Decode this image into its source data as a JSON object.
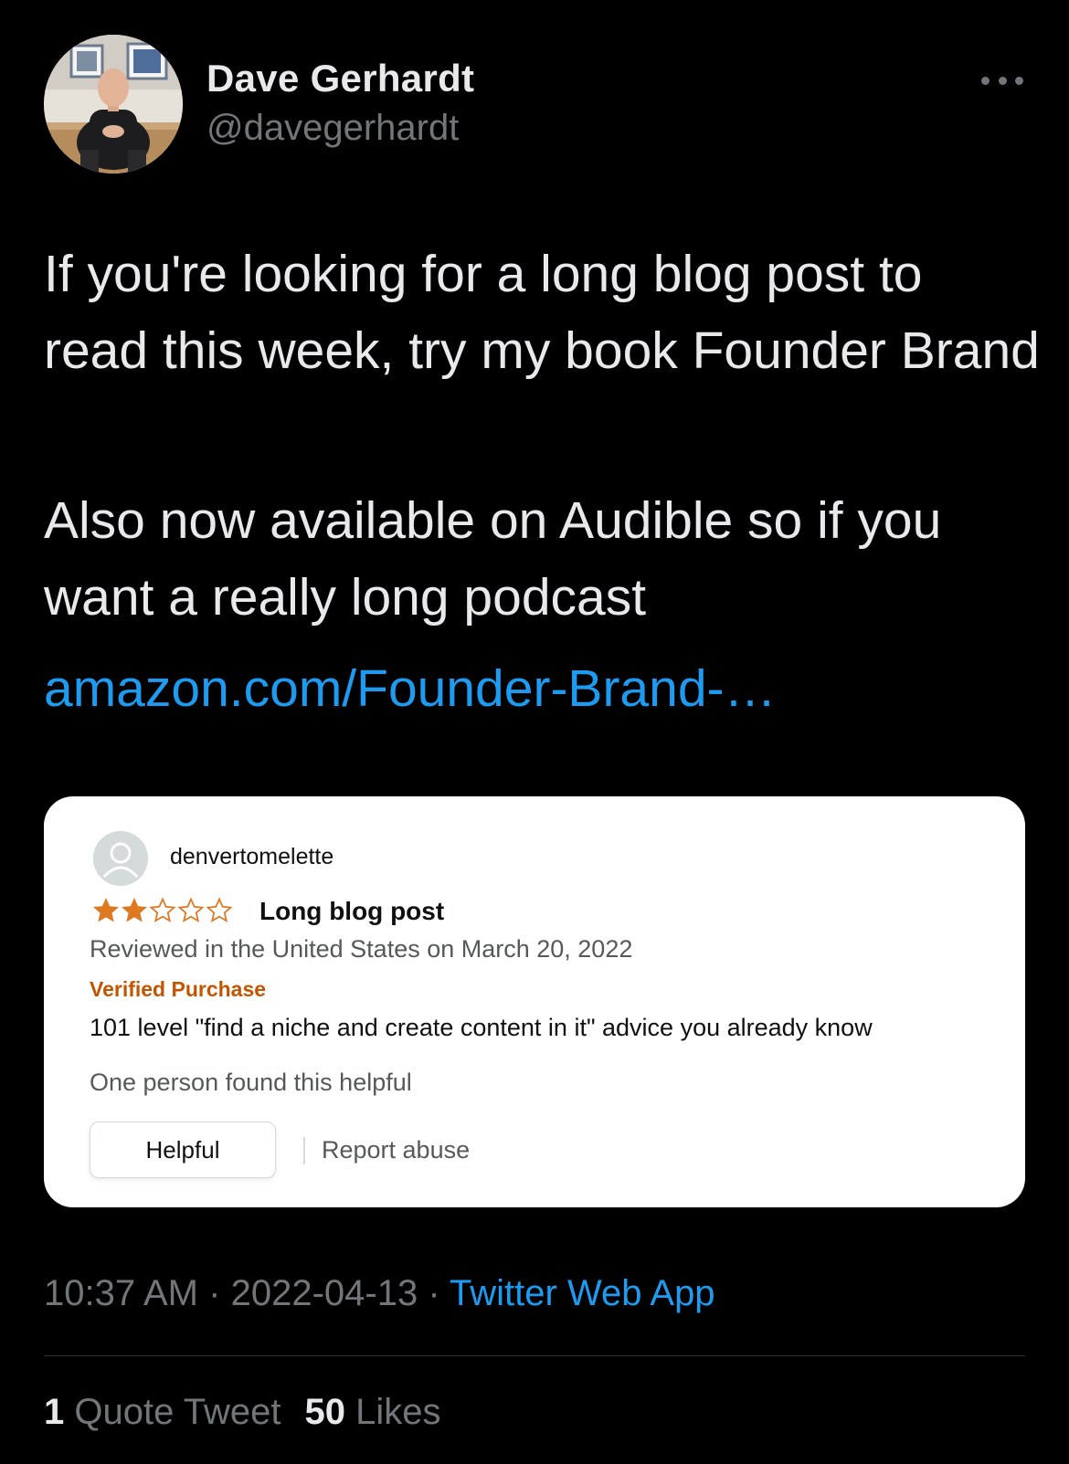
{
  "author": {
    "name": "Dave Gerhardt",
    "handle": "@davegerhardt"
  },
  "tweet": {
    "paragraph1": "If you're looking for a long blog post to read this week, try my book Founder Brand",
    "paragraph2": "Also now available on Audible so if you want a really long podcast",
    "link": "amazon.com/Founder-Brand-…"
  },
  "review": {
    "reviewer": "denvertomelette",
    "rating": 2,
    "max_rating": 5,
    "title": "Long blog post",
    "date_line": "Reviewed in the United States on March 20, 2022",
    "verified": "Verified Purchase",
    "body": "101 level \"find a niche and create content in it\" advice you already know",
    "helpful_count": "One person found this helpful",
    "helpful_button": "Helpful",
    "report": "Report abuse",
    "star_color": "#de7921"
  },
  "meta": {
    "time": "10:37 AM",
    "date": "2022-04-13",
    "separator": "·",
    "app": "Twitter Web App"
  },
  "stats": {
    "quote_count": "1",
    "quote_label": "Quote Tweet",
    "like_count": "50",
    "like_label": "Likes"
  },
  "colors": {
    "background": "#000000",
    "link": "#1d9bf0",
    "secondary": "#71767b"
  }
}
